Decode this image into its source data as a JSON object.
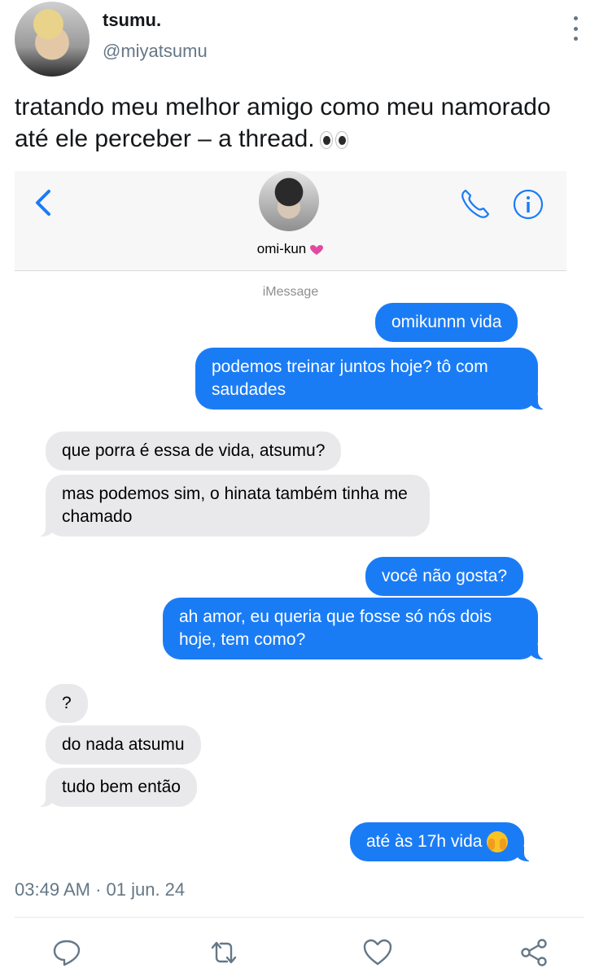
{
  "tweet": {
    "display_name": "tsumu.",
    "handle": "@miyatsumu",
    "text": "tratando meu melhor amigo como meu namorado até ele perceber – a thread.",
    "emoji": "eyes-emoji",
    "timestamp": "03:49 AM · 01 jun. 24"
  },
  "imessage": {
    "contact_name": "omi-kun",
    "contact_emoji": "sparkling-heart-emoji",
    "service_label": "iMessage",
    "messages": [
      {
        "side": "out",
        "text": "omikunnn vida"
      },
      {
        "side": "out",
        "text": "podemos treinar juntos hoje? tô com saudades"
      },
      {
        "side": "in",
        "text": "que porra é essa de vida, atsumu?"
      },
      {
        "side": "in",
        "text": "mas podemos sim, o hinata também tinha me chamado"
      },
      {
        "side": "out",
        "text": "você não gosta?"
      },
      {
        "side": "out",
        "text": "ah amor, eu queria que fosse só nós dois hoje, tem como?"
      },
      {
        "side": "in",
        "text": "?"
      },
      {
        "side": "in",
        "text": "do nada atsumu"
      },
      {
        "side": "in",
        "text": "tudo bem então"
      },
      {
        "side": "out",
        "text": "até às 17h vida",
        "emoji": "face-peeking-emoji"
      }
    ]
  },
  "colors": {
    "imessage_blue": "#1a7cf5",
    "incoming_gray": "#e9e9eb",
    "secondary_text": "#657786"
  },
  "actions": [
    "reply-icon",
    "retweet-icon",
    "like-icon",
    "share-icon"
  ]
}
